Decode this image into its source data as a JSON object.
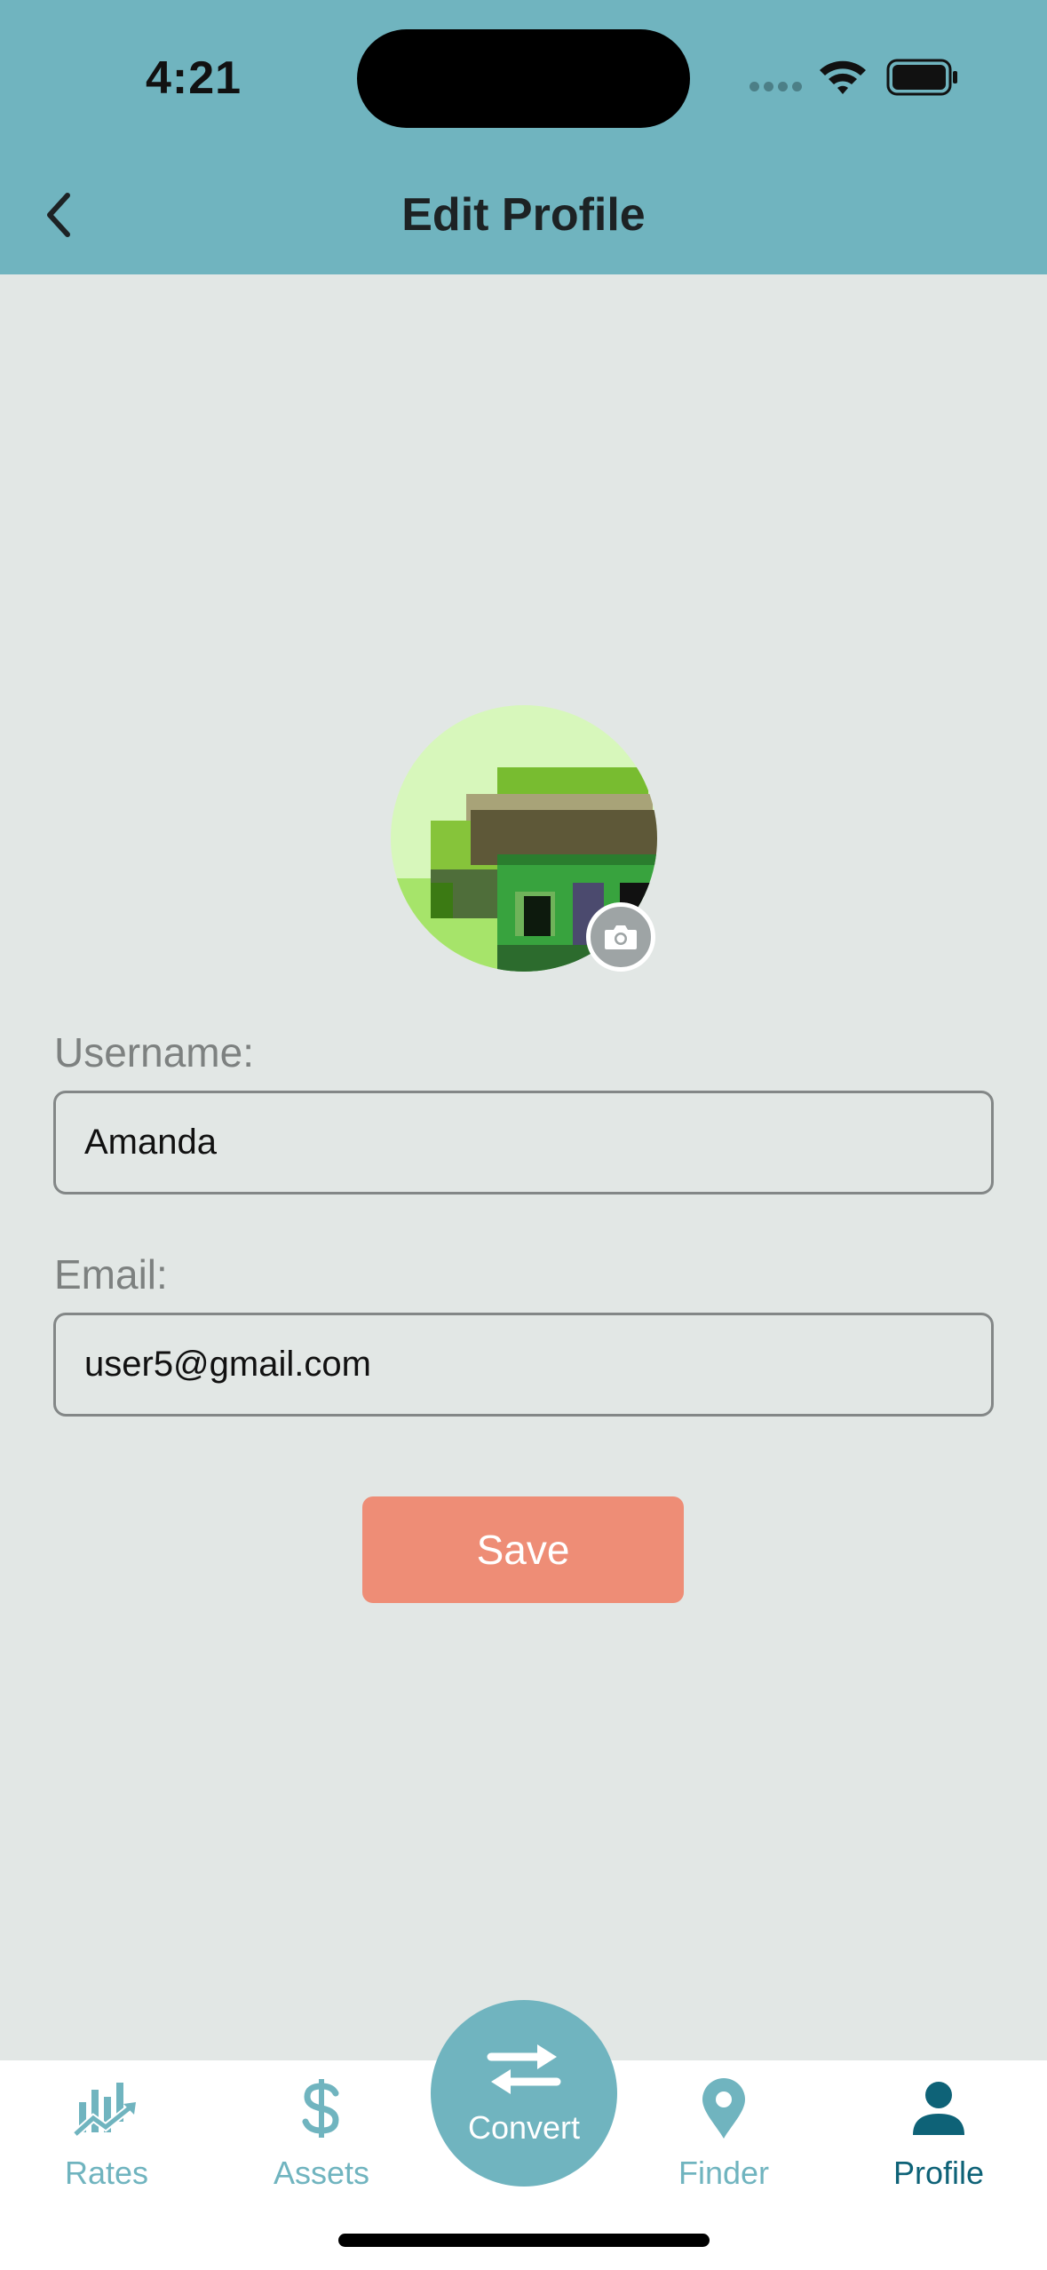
{
  "status_bar": {
    "time": "4:21",
    "icons": [
      "signal-icon",
      "wifi-icon",
      "battery-icon"
    ]
  },
  "header": {
    "title": "Edit Profile",
    "back_icon": "chevron-left-icon"
  },
  "avatar": {
    "icon": "camera-icon"
  },
  "form": {
    "username_label": "Username:",
    "username_value": "Amanda",
    "email_label": "Email:",
    "email_value": "user5@gmail.com",
    "save_label": "Save"
  },
  "tabs": [
    {
      "label": "Rates",
      "icon": "chart-trend-icon",
      "active": false
    },
    {
      "label": "Assets",
      "icon": "dollar-icon",
      "active": false
    },
    {
      "label": "Convert",
      "icon": "swap-arrows-icon",
      "active": false
    },
    {
      "label": "Finder",
      "icon": "map-pin-icon",
      "active": false
    },
    {
      "label": "Profile",
      "icon": "person-icon",
      "active": true
    }
  ],
  "colors": {
    "header_bg": "#70b4bf",
    "page_bg": "#e2e7e5",
    "save_button": "#ee8d76",
    "tab_inactive": "#70b4bf",
    "tab_active": "#0e6277"
  }
}
